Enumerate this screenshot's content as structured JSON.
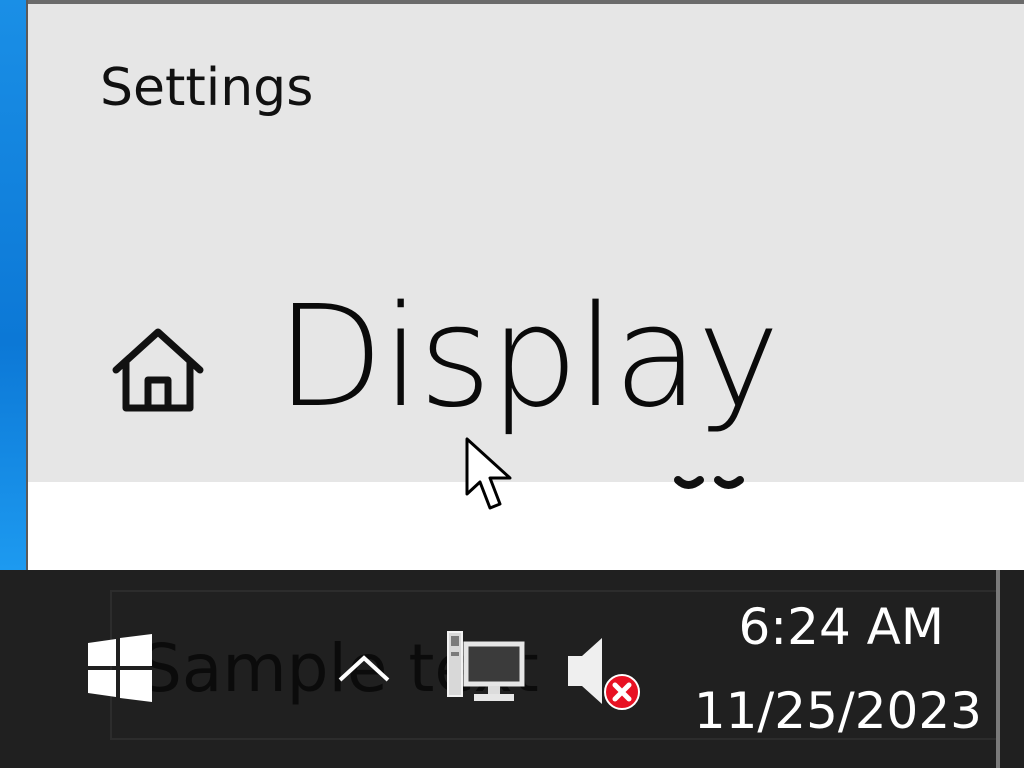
{
  "window": {
    "app_title": "Settings",
    "page_title": "Display",
    "home_icon": "home-icon"
  },
  "taskbar": {
    "ghost_text": "Sample text",
    "start_icon": "windows-logo-icon",
    "chevron_icon": "chevron-up-icon",
    "network_icon": "network-icon",
    "volume_icon": "volume-muted-icon",
    "clock": {
      "time": "6:24 AM",
      "date": "11/25/2023"
    }
  },
  "colors": {
    "title_bar_bg": "#e6e6e6",
    "taskbar_bg": "#202020",
    "desktop_accent": "#0c78d6",
    "mute_badge": "#e81123"
  }
}
